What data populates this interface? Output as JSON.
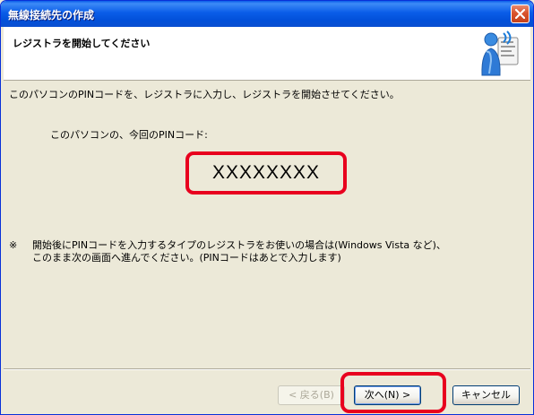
{
  "window": {
    "title": "無線接続先の作成"
  },
  "header": {
    "title": "レジストラを開始してください",
    "icon": "wireless-person-icon"
  },
  "main": {
    "instruction": "このパソコンのPINコードを、レジストラに入力し、レジストラを開始させてください。",
    "pin_label": "このパソコンの、今回のPINコード:",
    "pin_value": "XXXXXXXX",
    "note_mark": "※",
    "note_line1": "開始後にPINコードを入力するタイプのレジストラをお使いの場合は(Windows Vista など)、",
    "note_line2": "このまま次の画面へ進んでください。(PINコードはあとで入力します)"
  },
  "buttons": {
    "back": "< 戻る(B)",
    "next": "次へ(N) >",
    "cancel": "キャンセル"
  },
  "colors": {
    "highlight": "#E8001E",
    "titlebar": "#0A5DE8",
    "dialog_bg": "#ECE9D8"
  }
}
